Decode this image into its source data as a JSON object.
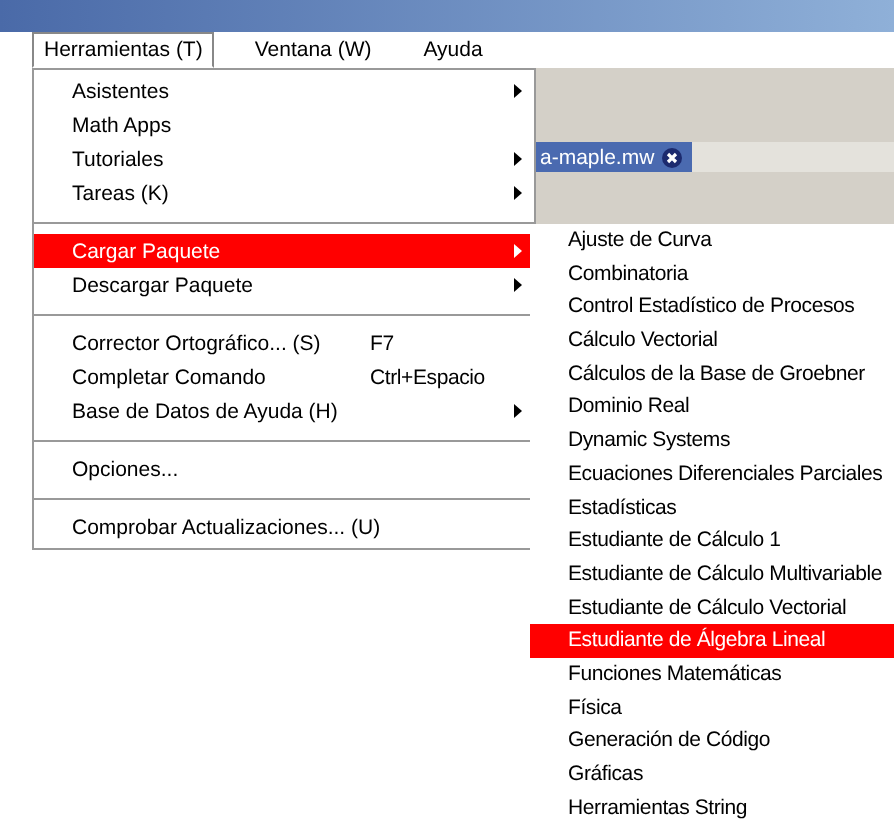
{
  "menu_bar": [
    {
      "label": "Herramientas (T)",
      "selected": true
    },
    {
      "label": "Ventana (W)",
      "selected": false
    },
    {
      "label": "Ayuda",
      "selected": false
    }
  ],
  "document_tab": {
    "label": "a-maple.mw"
  },
  "menu": [
    {
      "kind": "item",
      "label": "Asistentes",
      "submenu": true,
      "selected": false
    },
    {
      "kind": "item",
      "label": "Math Apps",
      "submenu": false,
      "selected": false
    },
    {
      "kind": "item",
      "label": "Tutoriales",
      "submenu": true,
      "selected": false
    },
    {
      "kind": "item",
      "label": "Tareas (K)",
      "submenu": true,
      "selected": false
    },
    {
      "kind": "separator"
    },
    {
      "kind": "item",
      "label": "Cargar Paquete",
      "submenu": true,
      "selected": true
    },
    {
      "kind": "item",
      "label": "Descargar Paquete",
      "submenu": true,
      "selected": false
    },
    {
      "kind": "separator"
    },
    {
      "kind": "item",
      "label": "Corrector Ortográfico... (S)",
      "shortcut": "F7",
      "submenu": false,
      "selected": false
    },
    {
      "kind": "item",
      "label": "Completar Comando",
      "shortcut": "Ctrl+Espacio",
      "submenu": false,
      "selected": false
    },
    {
      "kind": "item",
      "label": "Base de Datos de Ayuda (H)",
      "submenu": true,
      "selected": false
    },
    {
      "kind": "separator"
    },
    {
      "kind": "item",
      "label": "Opciones...",
      "submenu": false,
      "selected": false
    },
    {
      "kind": "separator"
    },
    {
      "kind": "item",
      "label": "Comprobar Actualizaciones... (U)",
      "submenu": false,
      "selected": false
    }
  ],
  "submenu": [
    {
      "label": "Ajuste de Curva",
      "selected": false
    },
    {
      "label": "Combinatoria",
      "selected": false
    },
    {
      "label": "Control Estadístico de Procesos",
      "selected": false
    },
    {
      "label": "Cálculo Vectorial",
      "selected": false
    },
    {
      "label": "Cálculos de la Base de Groebner",
      "selected": false
    },
    {
      "label": "Dominio Real",
      "selected": false
    },
    {
      "label": "Dynamic Systems",
      "selected": false
    },
    {
      "label": "Ecuaciones Diferenciales Parciales",
      "selected": false
    },
    {
      "label": "Estadísticas",
      "selected": false
    },
    {
      "label": "Estudiante de Cálculo 1",
      "selected": false
    },
    {
      "label": "Estudiante de Cálculo Multivariable",
      "selected": false
    },
    {
      "label": "Estudiante de Cálculo Vectorial",
      "selected": false
    },
    {
      "label": "Estudiante de Álgebra Lineal",
      "selected": true
    },
    {
      "label": "Funciones Matemáticas",
      "selected": false
    },
    {
      "label": "Física",
      "selected": false
    },
    {
      "label": "Generación de Código",
      "selected": false
    },
    {
      "label": "Gráficas",
      "selected": false
    },
    {
      "label": "Herramientas String",
      "selected": false
    }
  ]
}
